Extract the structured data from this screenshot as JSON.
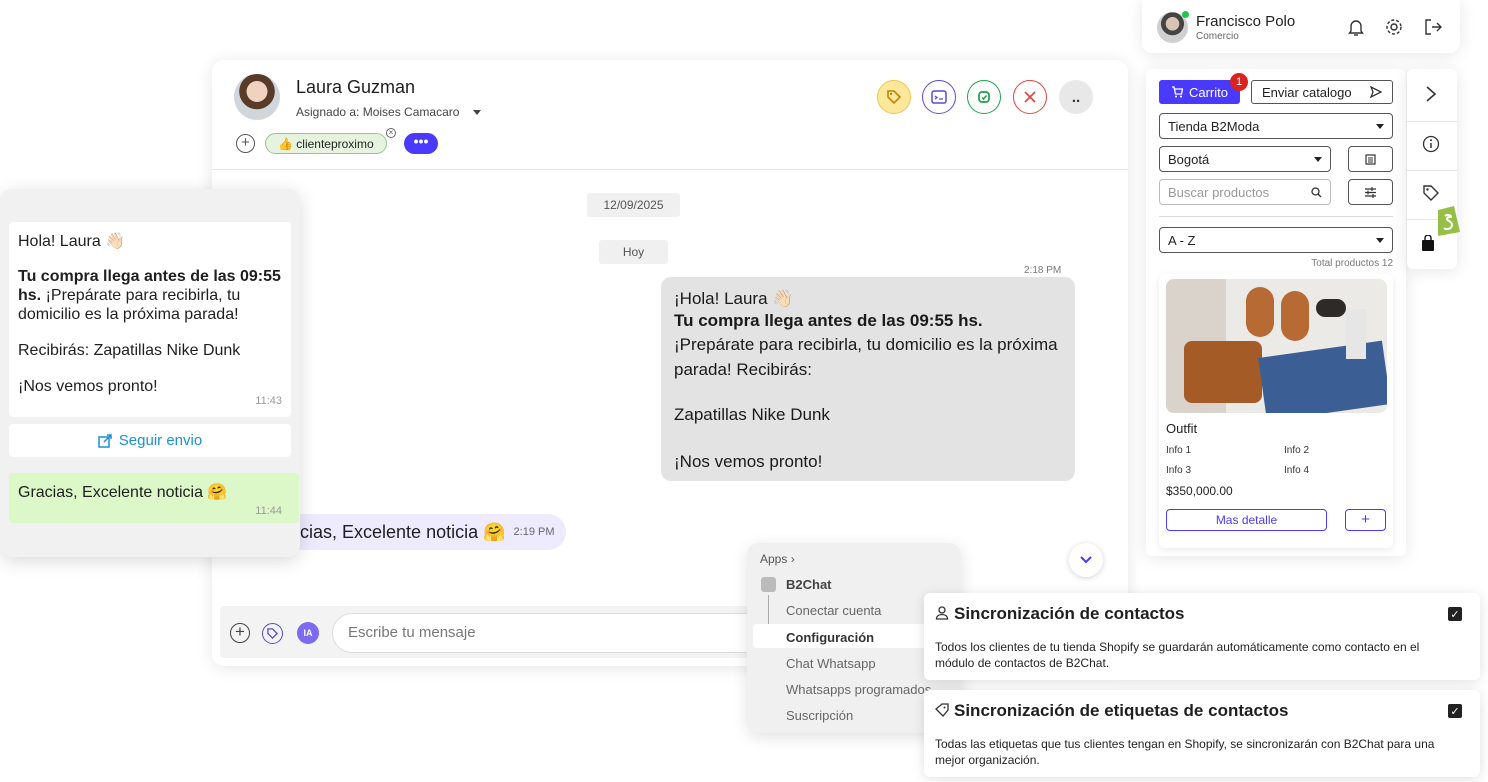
{
  "user": {
    "name": "Francisco Polo",
    "role": "Comercio"
  },
  "contact": {
    "name": "Laura Guzman",
    "assigned": "Asignado a: Moises Camacaro",
    "tag": "👍 clienteproximo"
  },
  "chat": {
    "date_chip": "12/09/2025",
    "today_chip": "Hoy",
    "msg_time": "2:18 PM",
    "msg_greeting": "¡Hola! Laura 👋🏻",
    "msg_bold": "Tu compra llega antes de las 09:55 hs.",
    "msg_body": "¡Prepárate para recibirla, tu domicilio es la próxima parada! Recibirás:",
    "msg_product": "Zapatillas Nike Dunk",
    "msg_bye": "¡Nos vemos pronto!",
    "reply_text": "acias, Excelente noticia 🤗",
    "reply_time": "2:19 PM",
    "input_placeholder": "Escribe tu mensaje",
    "ia_label": "IA"
  },
  "floating_chat": {
    "greeting": "Hola! Laura 👋🏻",
    "bold": "Tu compra llega antes de las 09:55 hs.",
    "after_bold": " ¡Prepárate para recibirla, tu domicilio es la próxima parada!",
    "receive": "Recibirás: Zapatillas Nike Dunk",
    "bye": "¡Nos vemos pronto!",
    "time1": "11:43",
    "track": "Seguir envio",
    "reply": "Gracias, Excelente noticia 🤗",
    "time2": "11:44"
  },
  "apps_menu": {
    "header": "Apps",
    "items": [
      "B2Chat",
      "Conectar cuenta",
      "Configuración",
      "Chat Whatsapp",
      "Whatsapps programados",
      "Suscripción"
    ]
  },
  "shop": {
    "cart_label": "Carrito",
    "cart_badge": "1",
    "catalog_label": "Enviar catalogo",
    "store": "Tienda B2Moda",
    "city": "Bogotá",
    "search_placeholder": "Buscar productos",
    "sort": "A - Z",
    "total": "Total productos 12",
    "product": {
      "name": "Outfit",
      "info": [
        "Info 1",
        "Info 2",
        "Info 3",
        "Info 4"
      ],
      "price": "$350,000.00",
      "detail_label": "Mas detalle",
      "add_label": "+"
    }
  },
  "sync": [
    {
      "title": "Sincronización de contactos",
      "desc": "Todos los clientes de tu tienda Shopify se guardarán automáticamente como contacto en el módulo de contactos de B2Chat."
    },
    {
      "title": "Sincronización de etiquetas de contactos",
      "desc": "Todas las etiquetas que tus clientes tengan en Shopify, se sincronizarán con B2Chat para una mejor organización."
    }
  ],
  "colors": {
    "accent": "#4a3aff",
    "chip_green": "#e6f4df",
    "bubble_grey": "#e3e3e3",
    "reply_green": "#dcf7c8",
    "link": "#1a8fd6"
  }
}
